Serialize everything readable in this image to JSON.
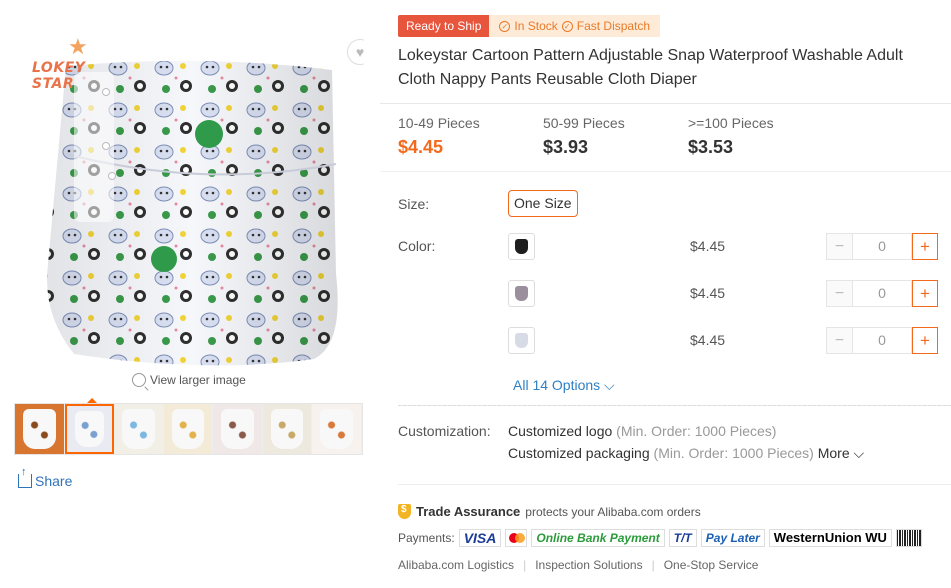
{
  "gallery": {
    "logo_text": "LOKEY STAR",
    "view_larger": "View larger image",
    "share_label": "Share",
    "thumbnails": [
      {
        "color": "#d8752e",
        "accent": "#8a4a1e"
      },
      {
        "color": "#eaeaf2",
        "accent": "#7aa0d0"
      },
      {
        "color": "#f1efe6",
        "accent": "#7cb8e0"
      },
      {
        "color": "#f3ebd7",
        "accent": "#e3b24c"
      },
      {
        "color": "#f0e8e6",
        "accent": "#8a5a4a"
      },
      {
        "color": "#ede9df",
        "accent": "#c9a86a"
      },
      {
        "color": "#f7f2ee",
        "accent": "#d97a3a"
      }
    ]
  },
  "badges": {
    "ready": "Ready to Ship",
    "in_stock": "In Stock",
    "fast_dispatch": "Fast Dispatch"
  },
  "product": {
    "title": "Lokeystar Cartoon Pattern Adjustable Snap Waterproof Washable Adult Cloth Nappy Pants Reusable Cloth Diaper"
  },
  "price_tiers": [
    {
      "qty": "10-49 Pieces",
      "price": "$4.45"
    },
    {
      "qty": "50-99 Pieces",
      "price": "$3.93"
    },
    {
      "qty": ">=100 Pieces",
      "price": "$3.53"
    }
  ],
  "options": {
    "size_label": "Size:",
    "size_value": "One Size",
    "color_label": "Color:",
    "rows": [
      {
        "price": "$4.45",
        "quantity": "0",
        "swatch": "#1e1e1e"
      },
      {
        "price": "$4.45",
        "quantity": "0",
        "swatch": "#9b8f9e"
      },
      {
        "price": "$4.45",
        "quantity": "0",
        "swatch": "#d7dbe6"
      }
    ],
    "minus": "−",
    "plus": "+",
    "all_options": "All 14 Options ⌵"
  },
  "customization": {
    "label": "Customization:",
    "logo_name": "Customized logo",
    "logo_min": "(Min. Order: 1000 Pieces)",
    "packaging_name": "Customized packaging",
    "packaging_min": "(Min. Order: 1000 Pieces)",
    "more": "More ⌵"
  },
  "trade": {
    "name": "Trade Assurance",
    "text": "protects your Alibaba.com orders"
  },
  "payments": {
    "label": "Payments:",
    "methods": [
      "VISA",
      "",
      "Online Bank Payment",
      "T/T",
      "Pay Later",
      "WesternUnion WU",
      ""
    ]
  },
  "services": [
    "Alibaba.com Logistics",
    "Inspection Solutions",
    "One-Stop Service"
  ]
}
